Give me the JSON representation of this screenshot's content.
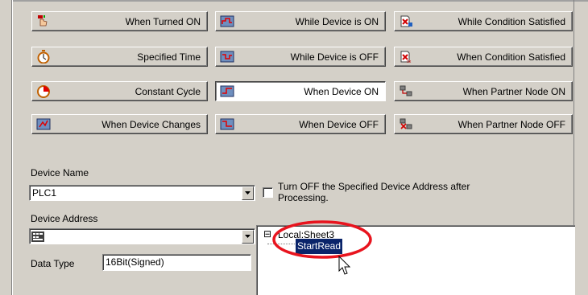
{
  "trigger_buttons": [
    {
      "label": "When Turned ON",
      "icon": "hand-press-icon"
    },
    {
      "label": "While Device is ON",
      "icon": "device-on-icon"
    },
    {
      "label": "While Condition Satisfied",
      "icon": "condition-icon"
    },
    {
      "label": "Specified Time",
      "icon": "stopwatch-icon"
    },
    {
      "label": "While Device is OFF",
      "icon": "device-off-icon"
    },
    {
      "label": "When Condition Satisfied",
      "icon": "condition-ok-icon"
    },
    {
      "label": "Constant Cycle",
      "icon": "cycle-clock-icon"
    },
    {
      "label": "When Device ON",
      "icon": "device-on-edge-icon",
      "selected": true
    },
    {
      "label": "When Partner Node ON",
      "icon": "partner-node-icon"
    },
    {
      "label": "When Device Changes",
      "icon": "device-change-icon"
    },
    {
      "label": "When Device OFF",
      "icon": "device-off-edge-icon"
    },
    {
      "label": "When Partner Node OFF",
      "icon": "partner-node-off-icon"
    }
  ],
  "device_name": {
    "label": "Device Name",
    "value": "PLC1"
  },
  "turn_off_option": {
    "line1": "Turn OFF the Specified Device Address after",
    "line2": "Processing.",
    "checked": false
  },
  "device_address": {
    "label": "Device Address",
    "value": ""
  },
  "data_type": {
    "label": "Data Type",
    "value": "16Bit(Signed)"
  },
  "tree": {
    "expander": "⊟",
    "root": "Local:Sheet3",
    "child": "StartRead"
  },
  "colors": {
    "selection": "#0a246a",
    "highlight_circle": "#e8141e",
    "face": "#d4d0c8"
  }
}
